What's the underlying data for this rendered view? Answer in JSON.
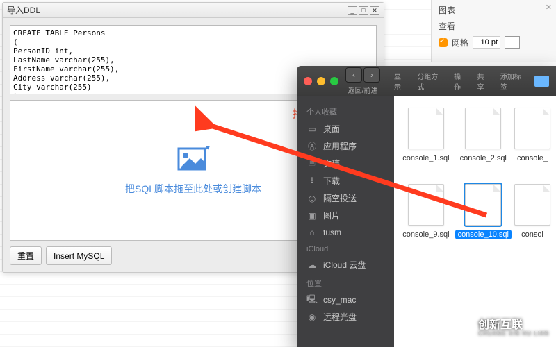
{
  "ddl": {
    "title": "导入DDL",
    "sql": "CREATE TABLE Persons\n(\nPersonID int,\nLastName varchar(255),\nFirstName varchar(255),\nAddress varchar(255),\nCity varchar(255)\n);",
    "drag_label": "拖动的输入框",
    "drop_text": "把SQL脚本拖至此处或创建脚本",
    "reset_btn": "重置",
    "insert_btn": "Insert MySQL"
  },
  "inspector": {
    "section1": "图表",
    "section2": "查看",
    "grid_label": "网格",
    "pt_value": "10 pt"
  },
  "finder": {
    "toolbar": {
      "back_fwd": "返回/前进",
      "view": "显示",
      "group": "分组方式",
      "action": "操作",
      "share": "共享",
      "tags": "添加标签"
    },
    "sidebar": {
      "favorites": "个人收藏",
      "items_fav": [
        "桌面",
        "应用程序",
        "文稿",
        "下载",
        "隔空投送",
        "图片",
        "tusm"
      ],
      "icloud_header": "iCloud",
      "icloud_items": [
        "iCloud 云盘"
      ],
      "locations": "位置",
      "loc_items": [
        "csy_mac",
        "远程光盘"
      ]
    },
    "files": [
      "console_1.sql",
      "console_2.sql",
      "console_",
      "console_9.sql",
      "console_10.sql",
      "consol"
    ],
    "selected": "console_10.sql"
  },
  "watermark": {
    "cn": "创新互联",
    "en": "CHUANG XIN HU LIAN"
  }
}
